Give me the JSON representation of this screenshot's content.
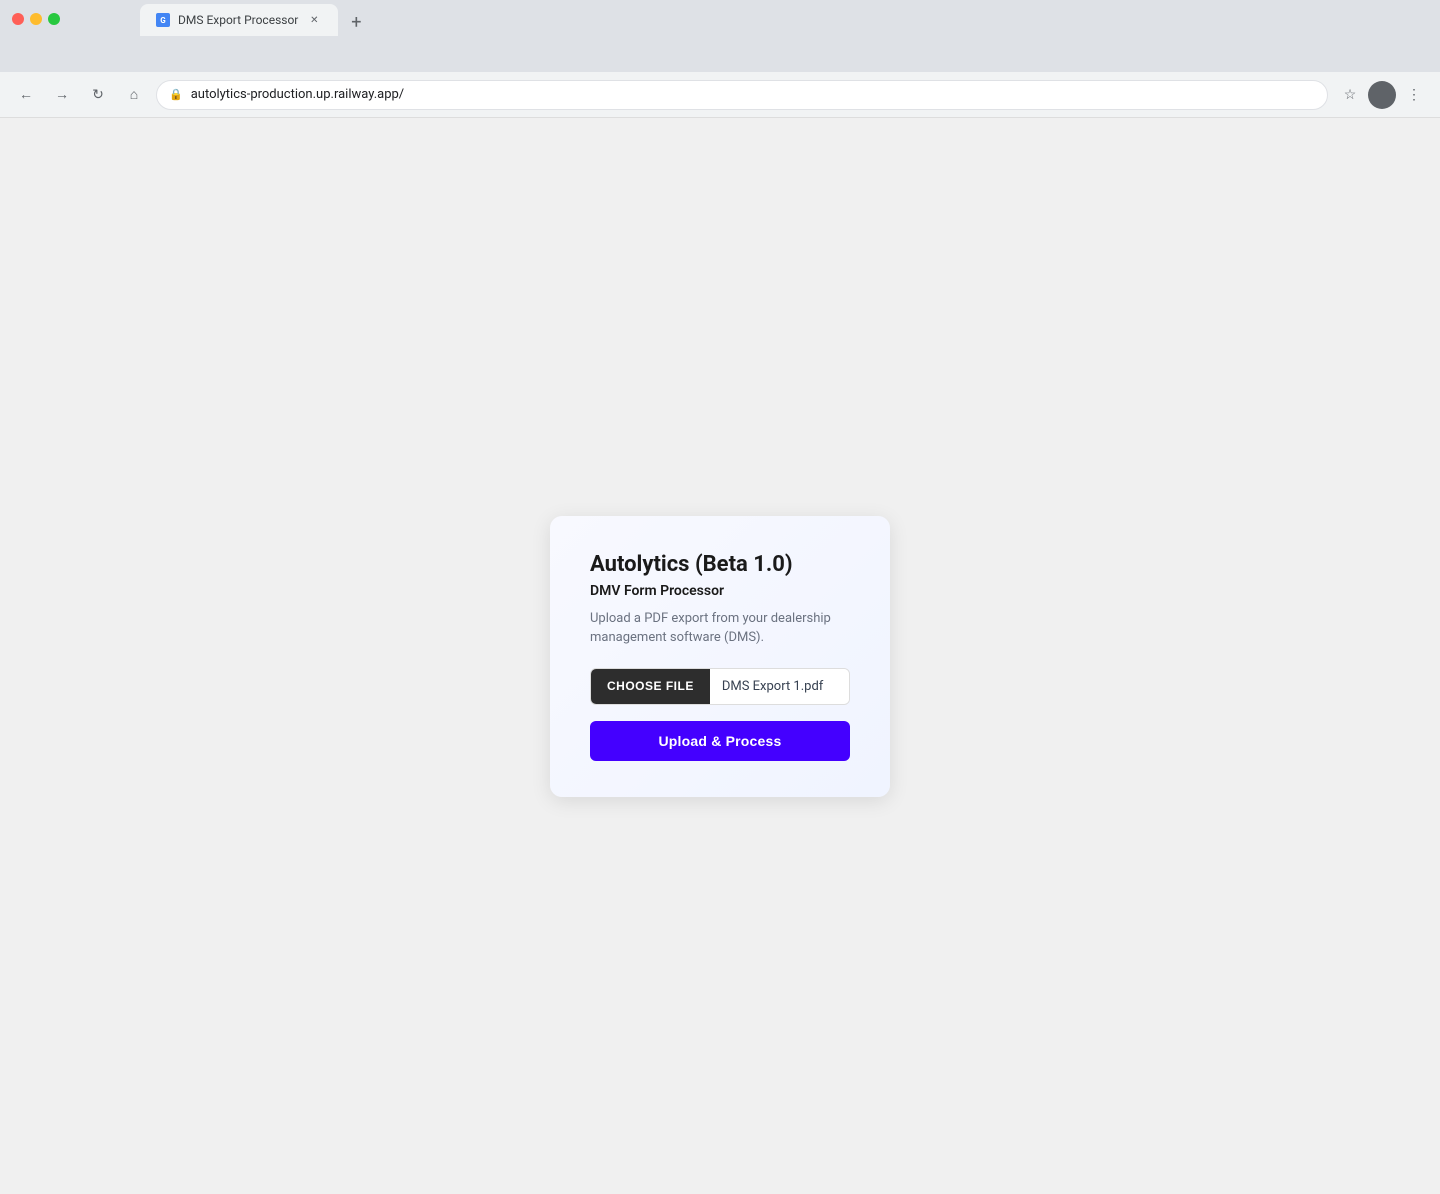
{
  "browser": {
    "tab_title": "DMS Export Processor",
    "url": "autolytics-production.up.railway.app/",
    "new_tab_label": "+"
  },
  "card": {
    "app_title": "Autolytics (Beta 1.0)",
    "app_subtitle": "DMV Form Processor",
    "app_description": "Upload a PDF export from your dealership management software (DMS).",
    "choose_file_label": "CHOOSE FILE",
    "file_name": "DMS Export 1.pdf",
    "upload_button_label": "Upload & Process"
  }
}
